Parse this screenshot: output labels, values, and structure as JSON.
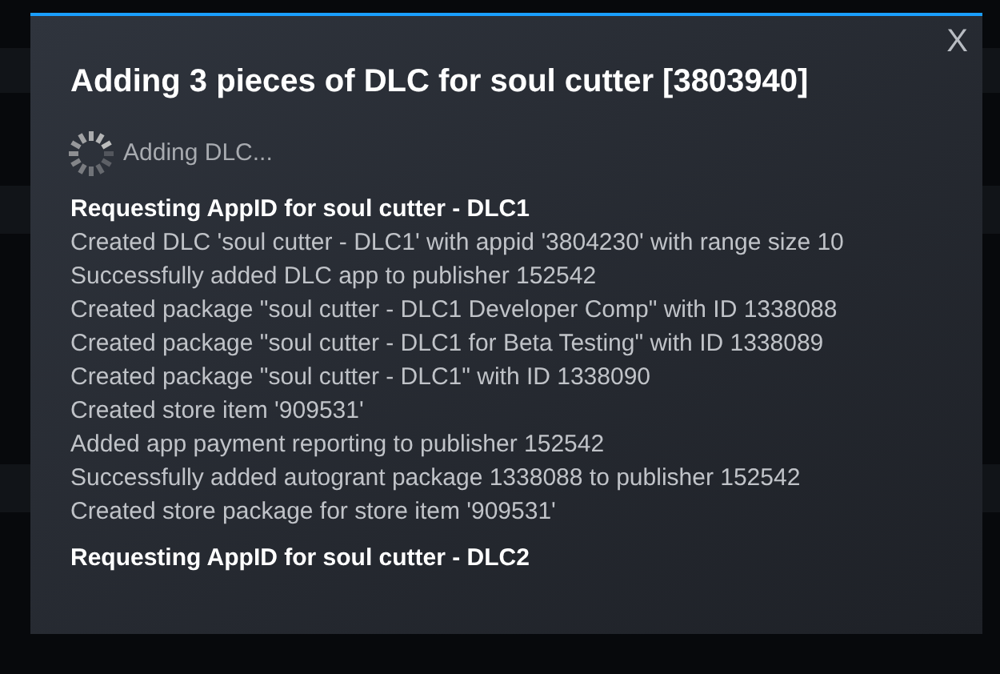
{
  "dialog": {
    "title": "Adding 3 pieces of DLC for soul cutter [3803940]",
    "close": "X",
    "status": "Adding DLC...",
    "sections": [
      {
        "heading": "Requesting AppID for soul cutter - DLC1",
        "lines": [
          "Created DLC 'soul cutter - DLC1' with appid '3804230' with range size 10",
          "Successfully added DLC app to publisher 152542",
          "Created package \"soul cutter - DLC1 Developer Comp\" with ID 1338088",
          "Created package \"soul cutter - DLC1 for Beta Testing\" with ID 1338089",
          "Created package \"soul cutter - DLC1\" with ID 1338090",
          "Created store item '909531'",
          "Added app payment reporting to publisher 152542",
          "Successfully added autogrant package 1338088 to publisher 152542",
          "Created store package for store item '909531'"
        ]
      },
      {
        "heading": "Requesting AppID for soul cutter - DLC2"
      }
    ]
  }
}
